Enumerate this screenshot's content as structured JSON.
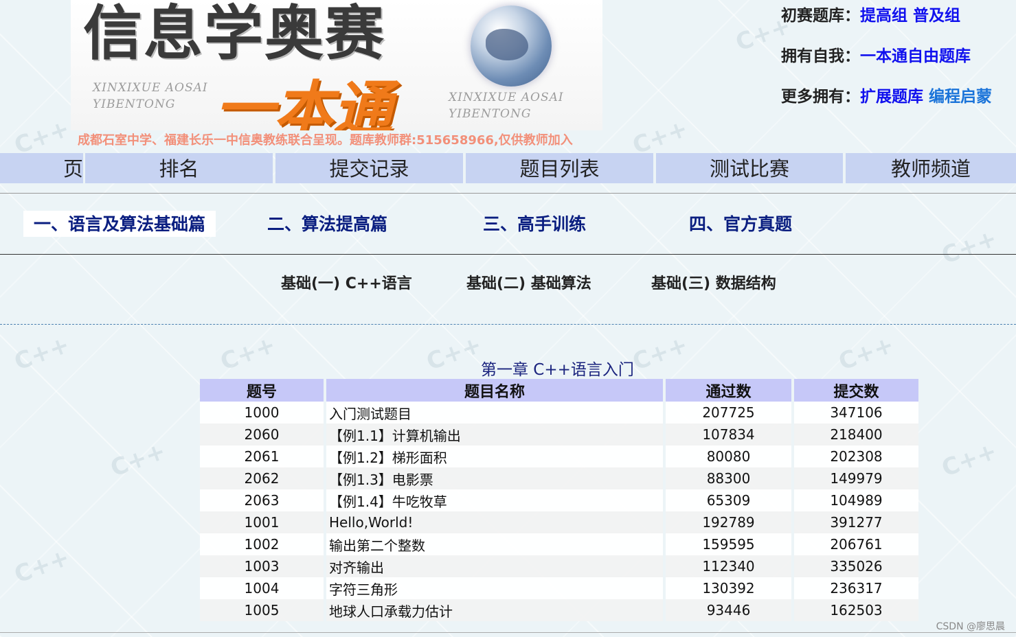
{
  "banner": {
    "title": "信息学奥赛",
    "subtitle": "一本通",
    "latin_left": [
      "XINXIXUE AOSAI",
      "YIBENTONG"
    ],
    "latin_right": [
      "XINXIXUE AOSAI",
      "YIBENTONG"
    ],
    "note": "成都石室中学、福建长乐一中信奥教练联合呈现。题库教师群:515658966,仅供教师加入"
  },
  "right_links": {
    "row1_label": "初赛题库：",
    "row1_link1": "提高组",
    "row1_link2": "普及组",
    "row2_label": "拥有自我：",
    "row2_link1": "一本通自由题库",
    "row3_label": "更多拥有：",
    "row3_link1": "扩展题库",
    "row3_link2": "编程启蒙"
  },
  "main_nav": [
    "页",
    "排名",
    "提交记录",
    "题目列表",
    "测试比赛",
    "教师频道"
  ],
  "categories": [
    "一、语言及算法基础篇",
    "二、算法提高篇",
    "三、高手训练",
    "四、官方真题"
  ],
  "sub_categories": [
    "基础(一) C++语言",
    "基础(二) 基础算法",
    "基础(三) 数据结构"
  ],
  "chapter_title": "第一章 C++语言入门",
  "table": {
    "headers": [
      "题号",
      "题目名称",
      "通过数",
      "提交数"
    ],
    "rows": [
      {
        "id": "1000",
        "name": "入门测试题目",
        "pass": "207725",
        "submit": "347106",
        "red": true
      },
      {
        "id": "2060",
        "name": "【例1.1】计算机输出",
        "pass": "107834",
        "submit": "218400",
        "red": true
      },
      {
        "id": "2061",
        "name": "【例1.2】梯形面积",
        "pass": "80080",
        "submit": "202308",
        "red": true
      },
      {
        "id": "2062",
        "name": "【例1.3】电影票",
        "pass": "88300",
        "submit": "149979",
        "red": true
      },
      {
        "id": "2063",
        "name": "【例1.4】牛吃牧草",
        "pass": "65309",
        "submit": "104989",
        "red": false
      },
      {
        "id": "1001",
        "name": "Hello,World!",
        "pass": "192789",
        "submit": "391277",
        "red": true
      },
      {
        "id": "1002",
        "name": "输出第二个整数",
        "pass": "159595",
        "submit": "206761",
        "red": true
      },
      {
        "id": "1003",
        "name": "对齐输出",
        "pass": "112340",
        "submit": "335026",
        "red": true
      },
      {
        "id": "1004",
        "name": "字符三角形",
        "pass": "130392",
        "submit": "236317",
        "red": true
      },
      {
        "id": "1005",
        "name": "地球人口承载力估计",
        "pass": "93446",
        "submit": "162503",
        "red": true
      }
    ]
  },
  "credit": "CSDN @廖思晨",
  "colors": {
    "nav_bg": "#c7d3f2",
    "header_bg": "#c6c8f8",
    "link_blue": "#1010ee",
    "link_sky": "#1a73d9",
    "id_red": "#e00000",
    "category_text": "#0a1e80",
    "note_orange": "#f2907a"
  }
}
